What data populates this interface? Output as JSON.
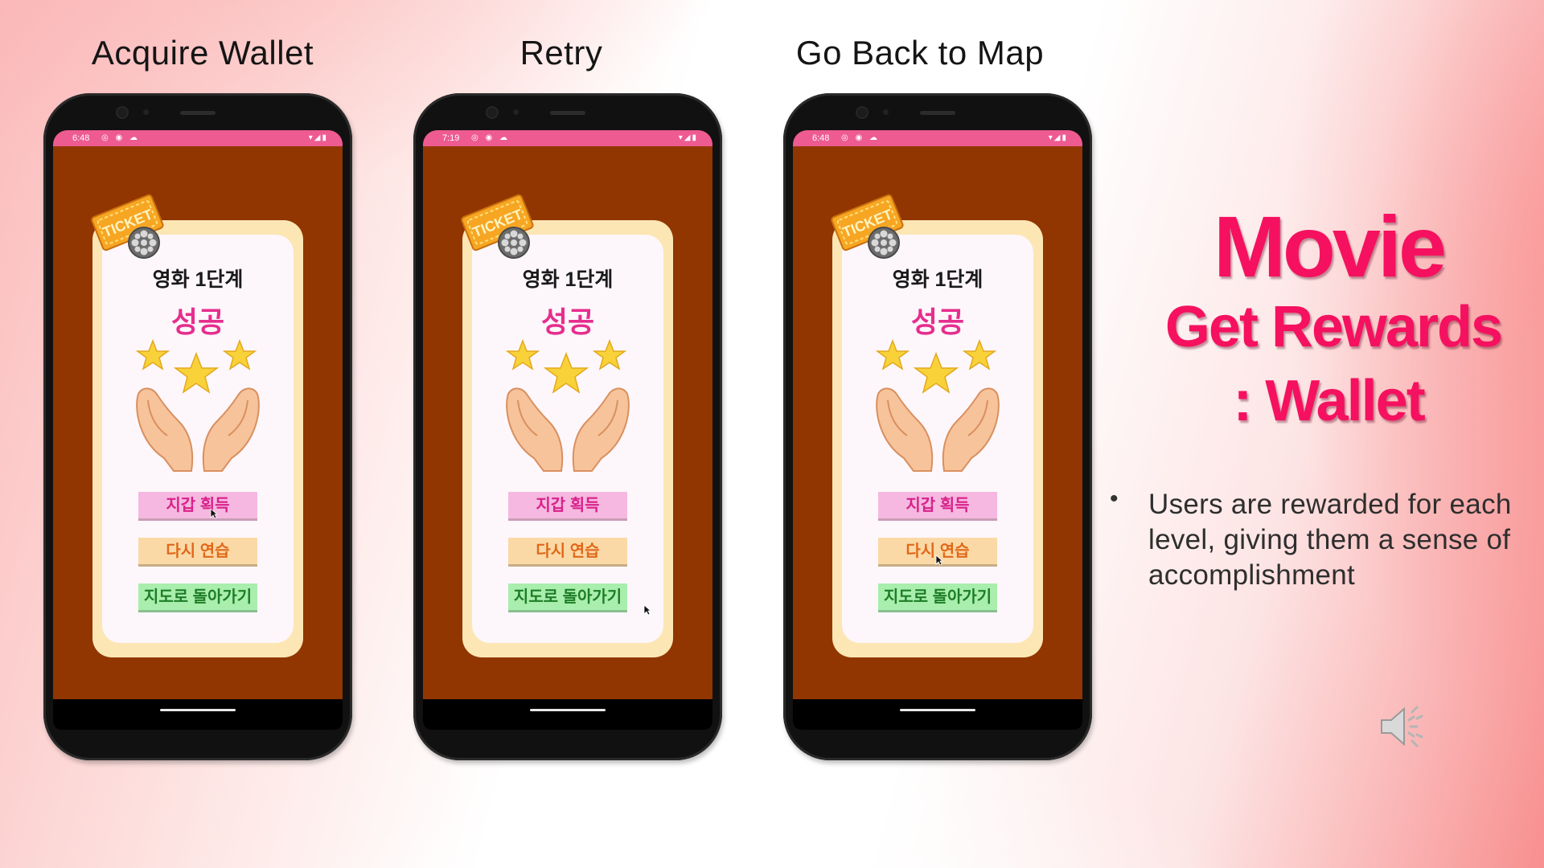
{
  "phones": [
    {
      "title": "Acquire Wallet",
      "status_time": "6:48",
      "stage": "영화 1단계",
      "result": "성공",
      "ticket_label": "TICKET",
      "buttons": {
        "wallet": "지갑 획득",
        "retry": "다시 연습",
        "map": "지도로 돌아가기"
      }
    },
    {
      "title": "Retry",
      "status_time": "7:19",
      "stage": "영화 1단계",
      "result": "성공",
      "ticket_label": "TICKET",
      "buttons": {
        "wallet": "지갑 획득",
        "retry": "다시 연습",
        "map": "지도로 돌아가기"
      }
    },
    {
      "title": "Go Back to Map",
      "status_time": "6:48",
      "stage": "영화 1단계",
      "result": "성공",
      "ticket_label": "TICKET",
      "buttons": {
        "wallet": "지갑 획득",
        "retry": "다시 연습",
        "map": "지도로 돌아가기"
      }
    }
  ],
  "heading": {
    "line1": "Movie",
    "line2": "Get Rewards",
    "line3": ": Wallet"
  },
  "bullet": {
    "marker": "•",
    "text": "Users are rewarded for each level, giving them a sense of accomplishment"
  },
  "icons": {
    "status_left": "notification-icons",
    "status_right": "wifi-signal-battery-icons",
    "audio": "speaker-icon"
  },
  "colors": {
    "heading": "#f5115f",
    "statusbar": "#ee5b91",
    "screen_bg": "#913600",
    "wallet_button": "#f6b8e0",
    "retry_button": "#fbd9a6",
    "map_button": "#a9eead"
  }
}
